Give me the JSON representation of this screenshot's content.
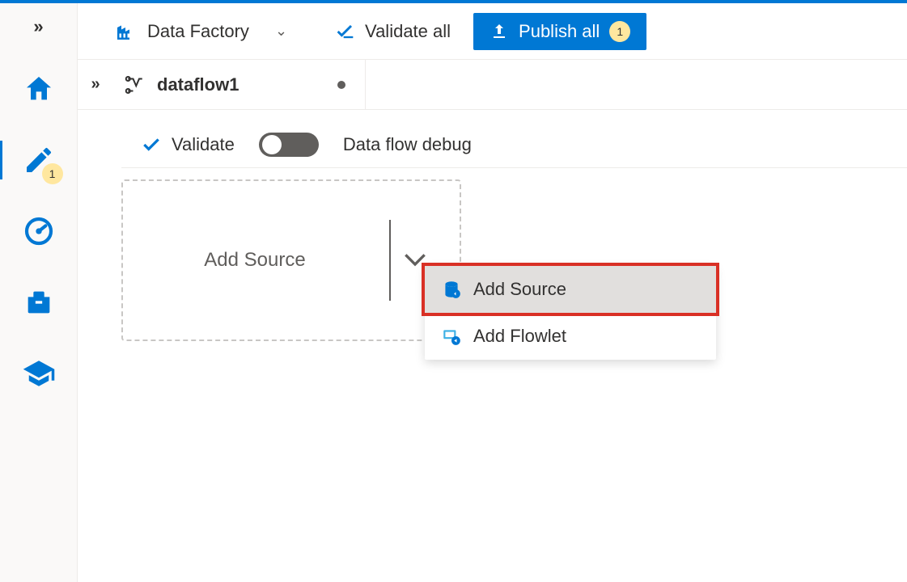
{
  "toolbar": {
    "factory_label": "Data Factory",
    "validate_all_label": "Validate all",
    "publish_label": "Publish all",
    "publish_badge": "1"
  },
  "rail": {
    "edit_badge": "1"
  },
  "tab": {
    "name": "dataflow1"
  },
  "subtoolbar": {
    "validate_label": "Validate",
    "debug_label": "Data flow debug"
  },
  "canvas": {
    "add_source_placeholder": "Add Source"
  },
  "menu": {
    "add_source": "Add Source",
    "add_flowlet": "Add Flowlet"
  }
}
